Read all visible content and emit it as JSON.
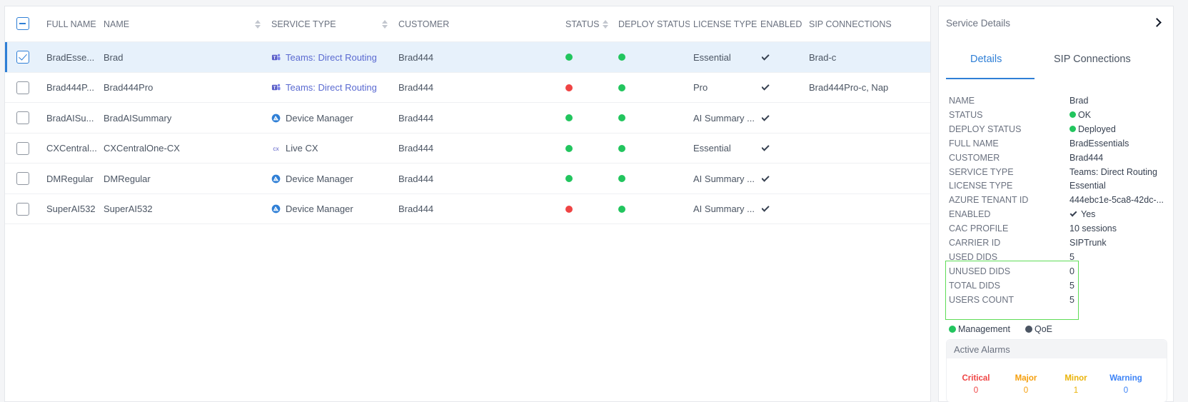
{
  "table": {
    "headers": {
      "full_name": "FULL NAME",
      "name": "NAME",
      "service_type": "SERVICE TYPE",
      "customer": "CUSTOMER",
      "status": "STATUS",
      "deploy_status": "DEPLOY STATUS",
      "license_type": "LICENSE TYPE",
      "enabled": "ENABLED",
      "sip_connections": "SIP CONNECTIONS"
    },
    "rows": [
      {
        "full_name": "BradEsse...",
        "name": "Brad",
        "service_type": "Teams: Direct Routing",
        "service_icon": "teams-icon",
        "customer": "Brad444",
        "status": "green",
        "deploy_status": "green",
        "license_type": "Essential",
        "enabled": true,
        "sip_connections": "Brad-c",
        "selected": true
      },
      {
        "full_name": "Brad444P...",
        "name": "Brad444Pro",
        "service_type": "Teams: Direct Routing",
        "service_icon": "teams-icon",
        "customer": "Brad444",
        "status": "red",
        "deploy_status": "green",
        "license_type": "Pro",
        "enabled": true,
        "sip_connections": "Brad444Pro-c, Nap",
        "selected": false
      },
      {
        "full_name": "BradAISu...",
        "name": "BradAISummary",
        "service_type": "Device Manager",
        "service_icon": "device-manager-icon",
        "customer": "Brad444",
        "status": "green",
        "deploy_status": "green",
        "license_type": "AI Summary ...",
        "enabled": true,
        "sip_connections": "",
        "selected": false
      },
      {
        "full_name": "CXCentral...",
        "name": "CXCentralOne-CX",
        "service_type": "Live CX",
        "service_icon": "live-cx-icon",
        "customer": "Brad444",
        "status": "green",
        "deploy_status": "green",
        "license_type": "Essential",
        "enabled": true,
        "sip_connections": "",
        "selected": false
      },
      {
        "full_name": "DMRegular",
        "name": "DMRegular",
        "service_type": "Device Manager",
        "service_icon": "device-manager-icon",
        "customer": "Brad444",
        "status": "green",
        "deploy_status": "green",
        "license_type": "AI Summary ...",
        "enabled": true,
        "sip_connections": "",
        "selected": false
      },
      {
        "full_name": "SuperAI532",
        "name": "SuperAI532",
        "service_type": "Device Manager",
        "service_icon": "device-manager-icon",
        "customer": "Brad444",
        "status": "red",
        "deploy_status": "green",
        "license_type": "AI Summary ...",
        "enabled": true,
        "sip_connections": "",
        "selected": false
      }
    ]
  },
  "details": {
    "title": "Service Details",
    "tabs": [
      "Details",
      "SIP Connections"
    ],
    "active_tab": "Details",
    "fields": [
      {
        "key": "NAME",
        "value": "Brad"
      },
      {
        "key": "STATUS",
        "value": "OK",
        "dot": "green"
      },
      {
        "key": "DEPLOY STATUS",
        "value": "Deployed",
        "dot": "green"
      },
      {
        "key": "FULL NAME",
        "value": "BradEssentials"
      },
      {
        "key": "CUSTOMER",
        "value": "Brad444"
      },
      {
        "key": "SERVICE TYPE",
        "value": "Teams: Direct Routing"
      },
      {
        "key": "LICENSE TYPE",
        "value": "Essential"
      },
      {
        "key": "AZURE TENANT ID",
        "value": "444ebc1e-5ca8-42dc-..."
      },
      {
        "key": "ENABLED",
        "value": "Yes",
        "check": true
      },
      {
        "key": "CAC PROFILE",
        "value": "10 sessions"
      },
      {
        "key": "CARRIER ID",
        "value": "SIPTrunk"
      },
      {
        "key": "USED DIDS",
        "value": "5"
      },
      {
        "key": "UNUSED DIDS",
        "value": "0"
      },
      {
        "key": "TOTAL DIDS",
        "value": "5"
      },
      {
        "key": "USERS COUNT",
        "value": "5"
      }
    ],
    "legend": [
      {
        "label": "Management",
        "color": "#22c55e"
      },
      {
        "label": "QoE",
        "color": "#4b5563"
      }
    ],
    "alarms": {
      "title": "Active Alarms",
      "items": [
        {
          "label": "Critical",
          "value": "0",
          "color": "#ef4444"
        },
        {
          "label": "Major",
          "value": "0",
          "color": "#f59e0b"
        },
        {
          "label": "Minor",
          "value": "1",
          "color": "#eab308"
        },
        {
          "label": "Warning",
          "value": "0",
          "color": "#3b82f6"
        }
      ]
    }
  },
  "colors": {
    "accent": "#2f7fd6",
    "link": "#5a6ad1",
    "ok": "#22c55e",
    "error": "#ef4444",
    "highlight": "#5fdc56"
  }
}
